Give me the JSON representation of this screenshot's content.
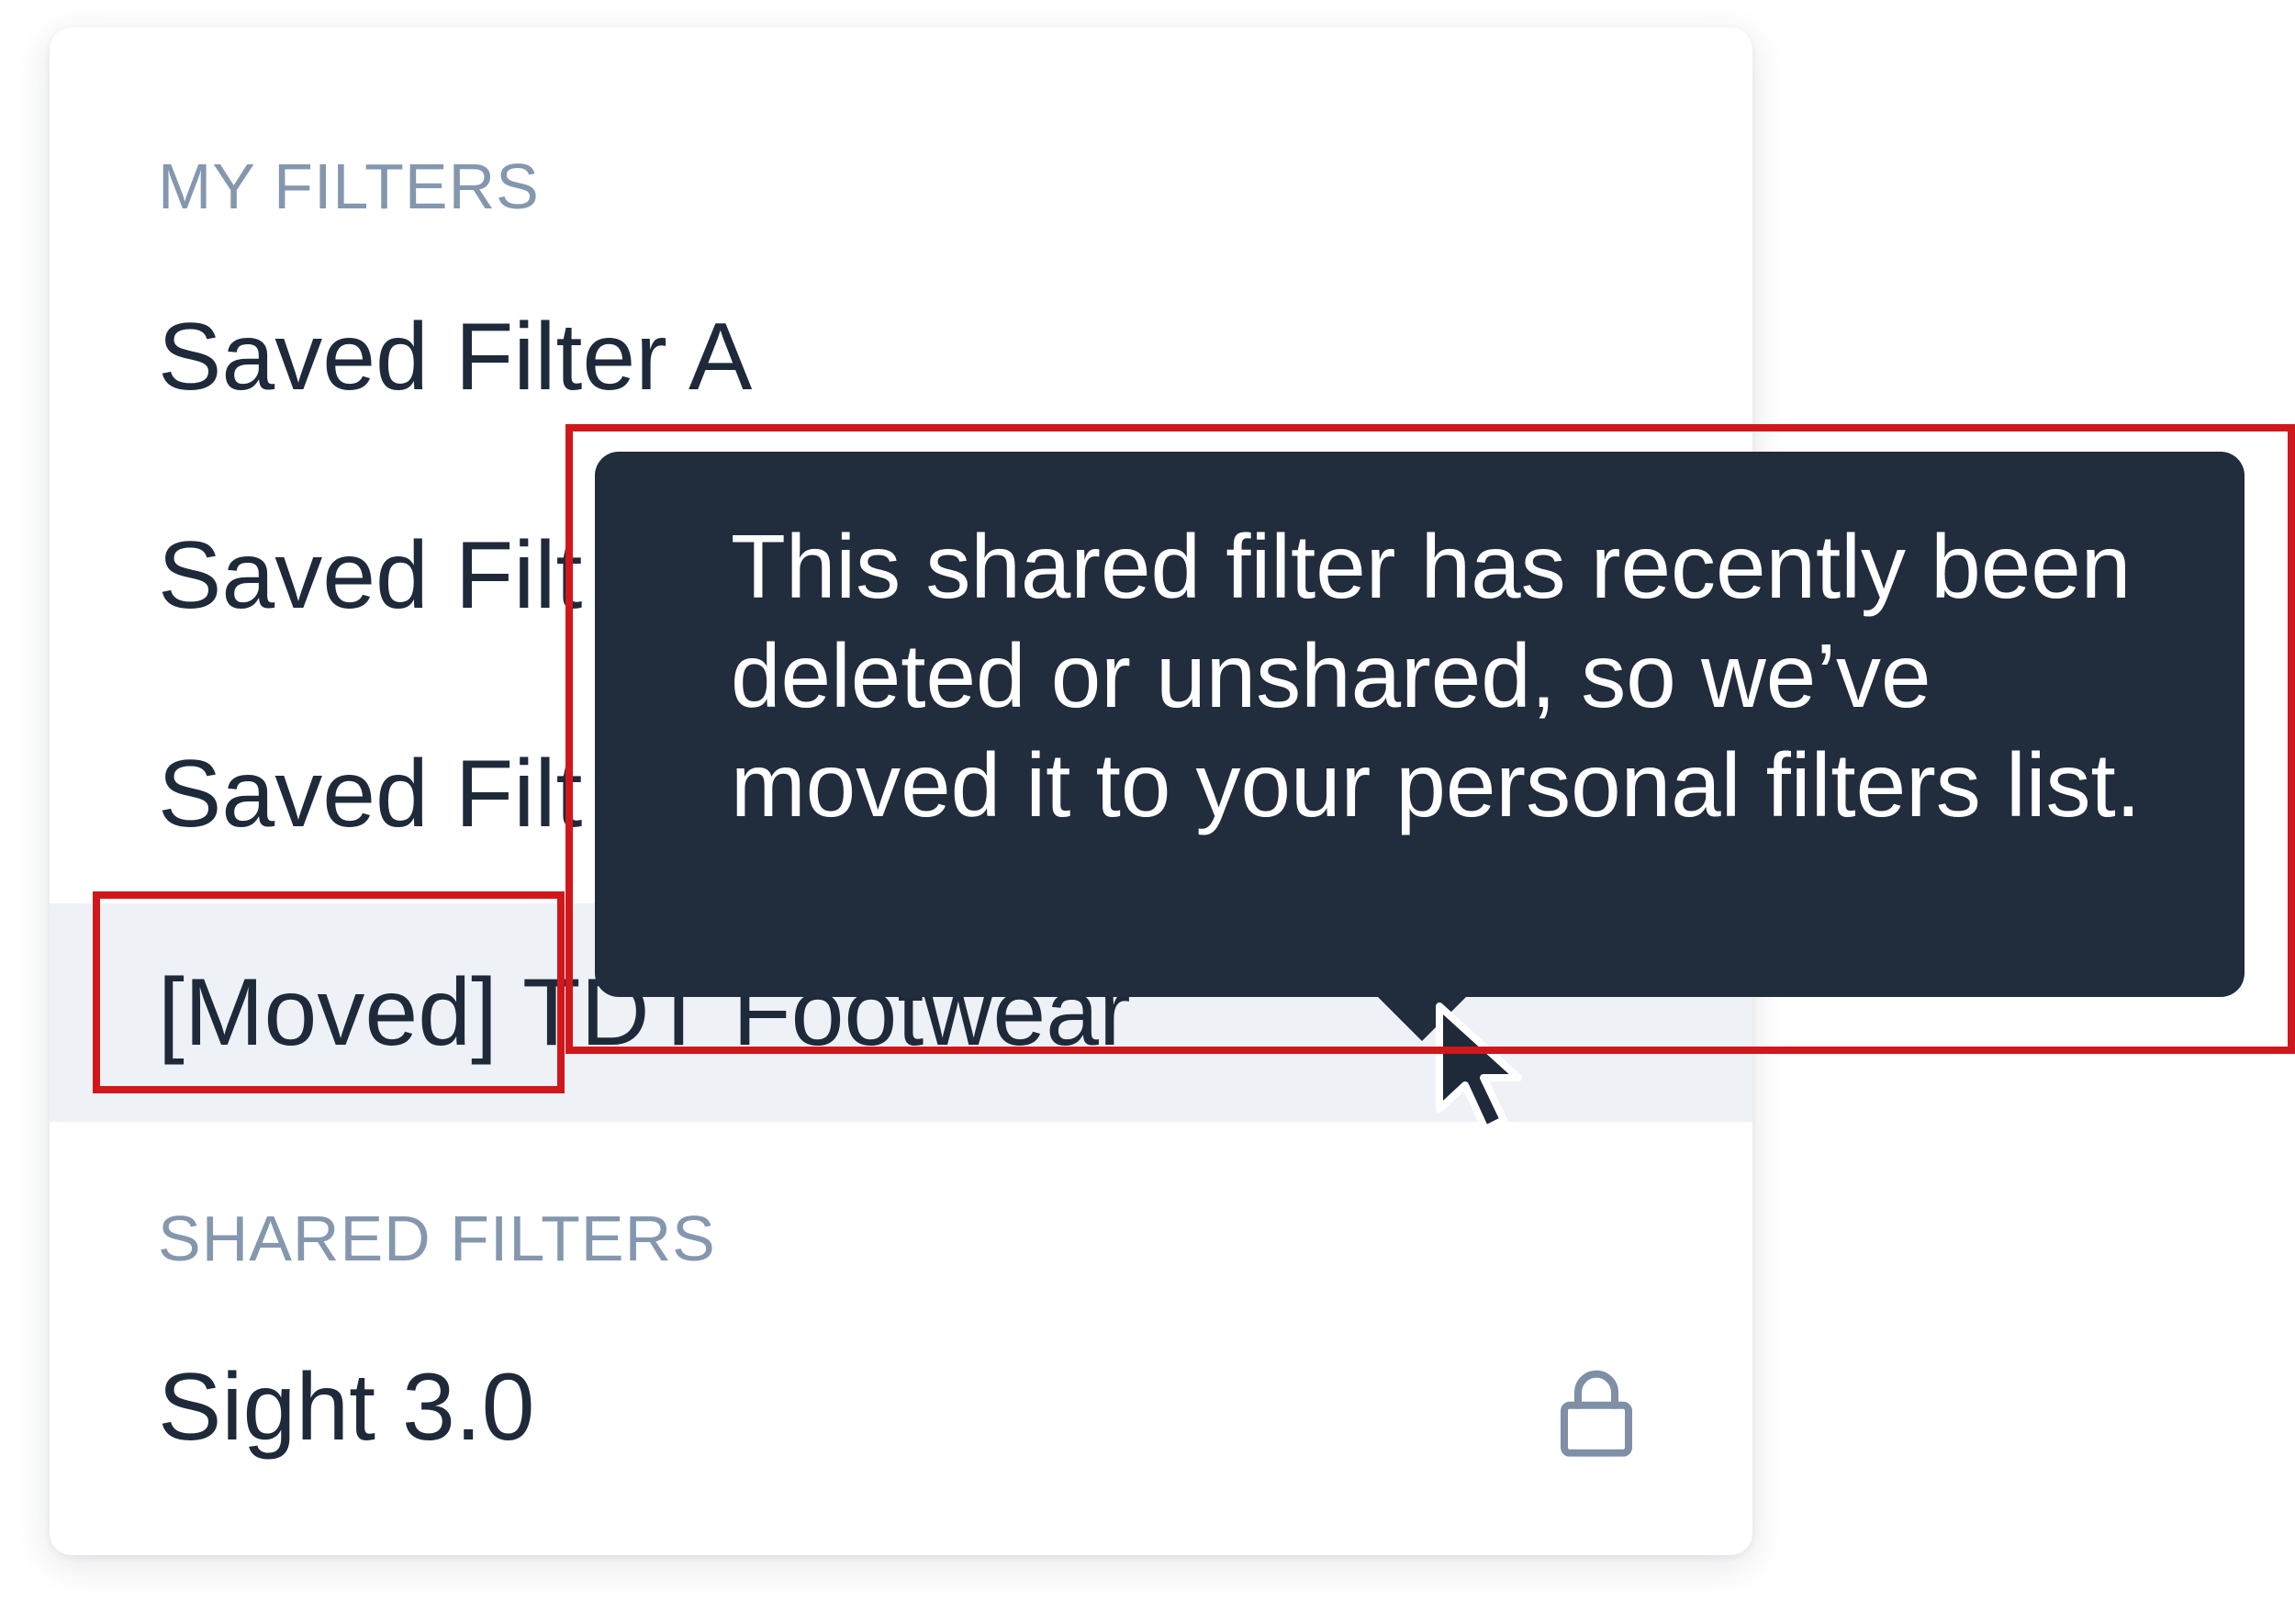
{
  "sections": {
    "my_filters": {
      "header": "MY FILTERS",
      "items": [
        {
          "label": "Saved Filter A"
        },
        {
          "label": "Saved Filt"
        },
        {
          "label": "Saved Filt"
        },
        {
          "label": "[Moved] TDT Footwear"
        }
      ]
    },
    "shared_filters": {
      "header": "SHARED FILTERS",
      "items": [
        {
          "label": "Sight 3.0",
          "icon": "lock-icon"
        }
      ]
    }
  },
  "tooltip": {
    "text": "This shared filter has recently been deleted or unshared, so we’ve moved it to your personal filters list."
  },
  "colors": {
    "tooltip_bg": "#212C3C",
    "section_header": "#8497AE",
    "item_text": "#1E2A3A",
    "highlight_bg": "#EEF1F6",
    "annotation": "#D0181C"
  }
}
